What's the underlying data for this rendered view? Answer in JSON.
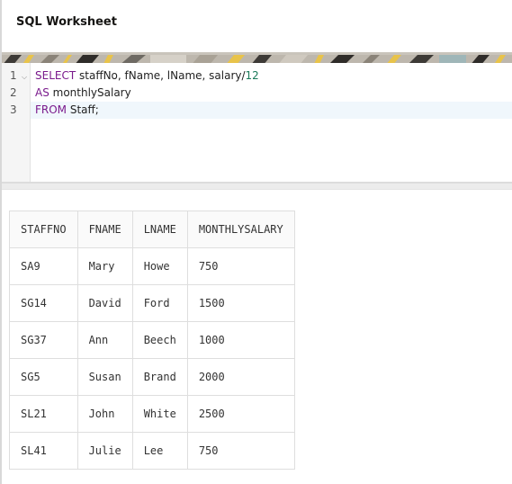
{
  "worksheet": {
    "title": "SQL Worksheet"
  },
  "editor": {
    "line_numbers": [
      "1",
      "2",
      "3"
    ],
    "lines": [
      {
        "keyword": "SELECT",
        "rest": " staffNo, fName, lName, salary/",
        "number": "12"
      },
      {
        "keyword": "AS",
        "rest": " monthlySalary",
        "number": ""
      },
      {
        "keyword": "FROM",
        "rest": " Staff;",
        "number": ""
      }
    ]
  },
  "results": {
    "columns": [
      "STAFFNO",
      "FNAME",
      "LNAME",
      "MONTHLYSALARY"
    ],
    "rows": [
      [
        "SA9",
        "Mary",
        "Howe",
        "750"
      ],
      [
        "SG14",
        "David",
        "Ford",
        "1500"
      ],
      [
        "SG37",
        "Ann",
        "Beech",
        "1000"
      ],
      [
        "SG5",
        "Susan",
        "Brand",
        "2000"
      ],
      [
        "SL21",
        "John",
        "White",
        "2500"
      ],
      [
        "SL41",
        "Julie",
        "Lee",
        "750"
      ]
    ]
  }
}
